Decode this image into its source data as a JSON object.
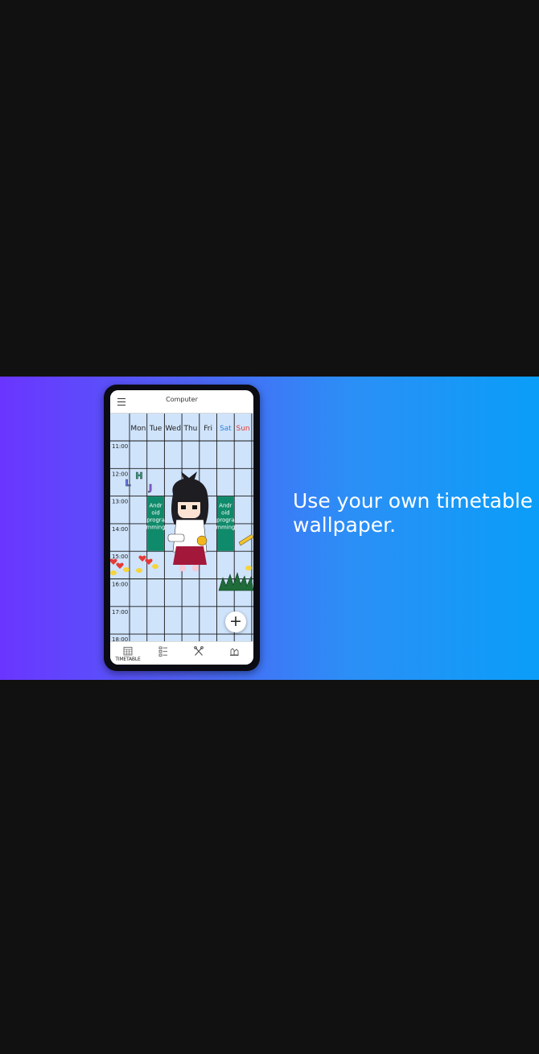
{
  "banner": {
    "tagline": "Use your own timetable wallpaper."
  },
  "app": {
    "title": "Computer",
    "days": [
      "Mon",
      "Tue",
      "Wed",
      "Thu",
      "Fri",
      "Sat",
      "Sun"
    ],
    "hours": [
      "11:00",
      "12:00",
      "13:00",
      "14:00",
      "15:00",
      "16:00",
      "17:00",
      "18:00"
    ],
    "classes": [
      {
        "day": "Tue",
        "start": "13:00",
        "end": "15:00",
        "lines": [
          "Andr",
          "oid",
          "progra",
          "mming"
        ]
      },
      {
        "day": "Thu",
        "start": "13:00",
        "end": "15:00",
        "lines": [
          "Andr",
          "oid",
          "progra",
          "mming"
        ]
      },
      {
        "day": "Sat",
        "start": "13:00",
        "end": "15:00",
        "lines": [
          "Andr",
          "oid",
          "progra",
          "mming"
        ]
      }
    ],
    "sticker_letters": [
      "L",
      "H",
      "J"
    ],
    "fab_label": "+",
    "nav": [
      {
        "label": "TIMETABLE",
        "icon": "calendar-grid-icon"
      },
      {
        "label": "",
        "icon": "checklist-icon"
      },
      {
        "label": "",
        "icon": "crossed-tools-icon"
      },
      {
        "label": "",
        "icon": "settings-icon"
      }
    ]
  },
  "colors": {
    "class_block": "#0f8a6a",
    "sun_label": "#e53935",
    "sat_label": "#2f7fd6",
    "grid_bg": "#cfe3fb",
    "banner_left": "#6a35ff",
    "banner_right": "#0a9ef8"
  }
}
